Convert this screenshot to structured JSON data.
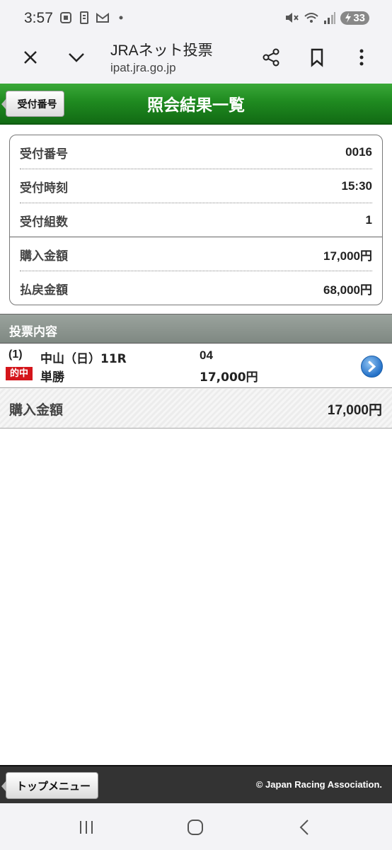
{
  "status": {
    "time": "3:57",
    "battery": "33",
    "icons": [
      "screenshot-icon",
      "sim-icon",
      "gmail-icon",
      "dot-icon",
      "mute-icon",
      "wifi-icon",
      "signal-icon",
      "battery-charging-icon"
    ]
  },
  "browser": {
    "title": "JRAネット投票",
    "url": "ipat.jra.go.jp"
  },
  "header": {
    "back_label": "受付番号",
    "title": "照会結果一覧"
  },
  "summary": {
    "rows": [
      {
        "label": "受付番号",
        "value": "0016"
      },
      {
        "label": "受付時刻",
        "value": "15:30"
      },
      {
        "label": "受付組数",
        "value": "1"
      },
      {
        "label": "購入金額",
        "value": "17,000円"
      },
      {
        "label": "払戻金額",
        "value": "68,000円"
      }
    ]
  },
  "section": {
    "title": "投票内容"
  },
  "bet": {
    "number": "(1)",
    "race": "中山（日）11R",
    "horse": "04",
    "badge": "的中",
    "type": "単勝",
    "amount": "17,000円"
  },
  "total": {
    "label": "購入金額",
    "value": "17,000円"
  },
  "footer": {
    "top_menu_label": "トップメニュー",
    "copyright": "© Japan Racing Association."
  },
  "colors": {
    "header_green": "#1f8a20",
    "hit_red": "#d4151b",
    "section_gray": "#8a938d",
    "footer_dark": "#333333"
  }
}
